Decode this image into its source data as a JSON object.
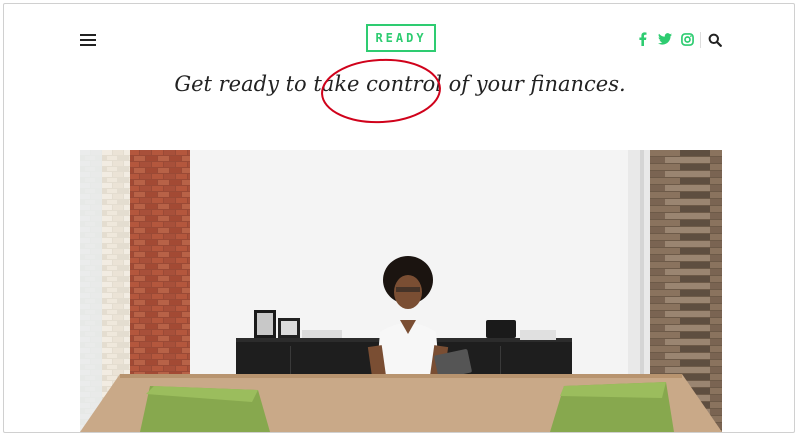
{
  "header": {
    "logo_text": "READY",
    "menu_icon": "hamburger-menu-icon",
    "social_icons": [
      "facebook-icon",
      "twitter-icon",
      "instagram-icon"
    ],
    "search_icon": "search-icon"
  },
  "tagline": "Get ready to take control of your finances.",
  "colors": {
    "accent": "#2ecc71",
    "annotation": "#d0021b",
    "text": "#222222"
  }
}
